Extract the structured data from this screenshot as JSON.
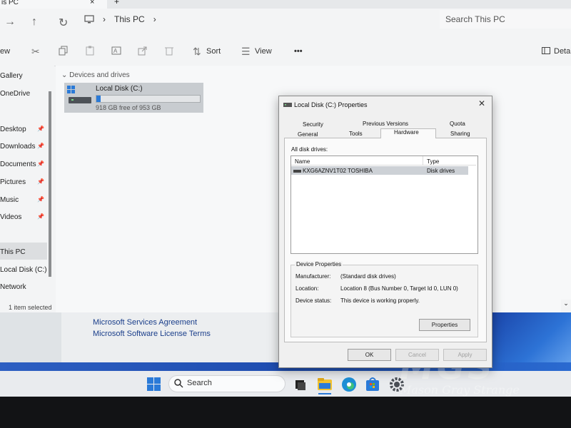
{
  "explorer": {
    "tab_title": "is PC",
    "close_glyph": "×",
    "new_tab_glyph": "+",
    "nav": {
      "forward": "→",
      "up": "↑",
      "refresh": "↻",
      "chevron": "›"
    },
    "breadcrumb": "This PC",
    "search_placeholder": "Search This PC",
    "toolbar": {
      "new_label": "ew",
      "sort_label": "Sort",
      "view_label": "View",
      "more_label": "•••",
      "details_label": "Detai"
    },
    "sidebar": [
      {
        "label": "Gallery",
        "pinned": false
      },
      {
        "label": "OneDrive",
        "pinned": false
      },
      {
        "label": "Desktop",
        "pinned": true
      },
      {
        "label": "Downloads",
        "pinned": true
      },
      {
        "label": "Documents",
        "pinned": true
      },
      {
        "label": "Pictures",
        "pinned": true
      },
      {
        "label": "Music",
        "pinned": true
      },
      {
        "label": "Videos",
        "pinned": true
      },
      {
        "label": "This PC",
        "pinned": false
      },
      {
        "label": "Local Disk (C:)",
        "pinned": false
      },
      {
        "label": "Network",
        "pinned": false
      }
    ],
    "group_header": "Devices and drives",
    "drive": {
      "name": "Local Disk (C:)",
      "free_text": "918 GB free of 953 GB",
      "used_fraction": 0.04
    },
    "status": "1 item selected"
  },
  "background": {
    "link1": "Microsoft Services Agreement",
    "link2": "Microsoft Software License Terms",
    "watermark_mark": "MGS",
    "watermark_name": "Mason Gray Strange"
  },
  "taskbar": {
    "search_label": "Search"
  },
  "dialog": {
    "title": "Local Disk (C:) Properties",
    "tabs_row1": [
      "Security",
      "Previous Versions",
      "Quota"
    ],
    "tabs_row2": [
      "General",
      "Tools",
      "Hardware",
      "Sharing"
    ],
    "all_disk_label": "All disk drives:",
    "columns": [
      "Name",
      "Type"
    ],
    "rows": [
      {
        "name": "KXG6AZNV1T02 TOSHIBA",
        "type": "Disk drives"
      }
    ],
    "device_props_title": "Device Properties",
    "props": [
      {
        "label": "Manufacturer:",
        "value": "(Standard disk drives)"
      },
      {
        "label": "Location:",
        "value": "Location 8 (Bus Number 0, Target Id 0, LUN 0)"
      },
      {
        "label": "Device status:",
        "value": "This device is working properly."
      }
    ],
    "properties_btn": "Properties",
    "ok": "OK",
    "cancel": "Cancel",
    "apply": "Apply"
  }
}
